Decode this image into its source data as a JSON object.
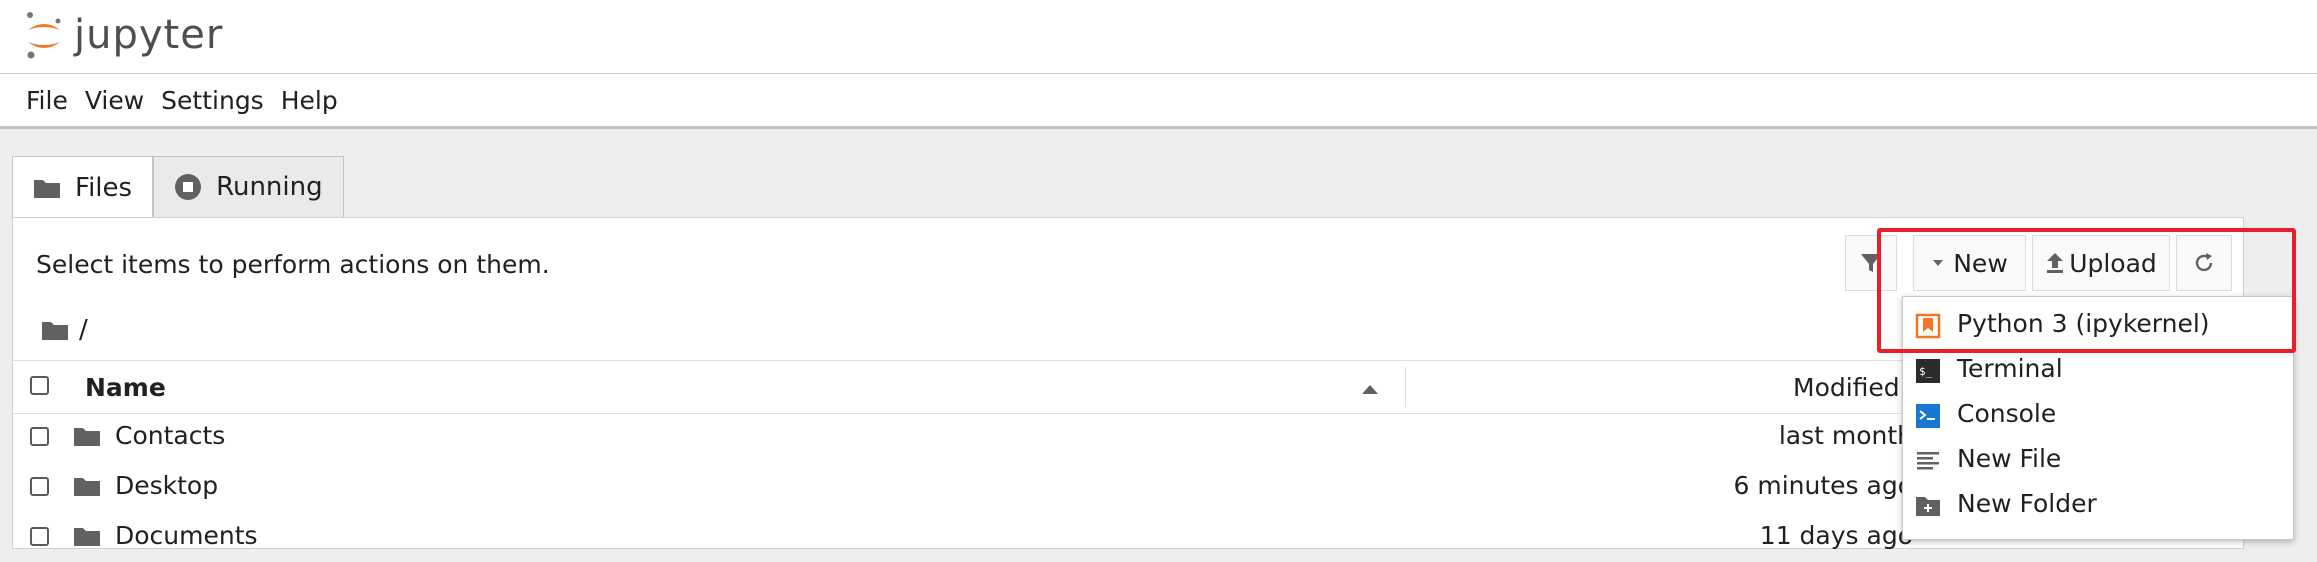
{
  "app": {
    "logo_text": "jupyter"
  },
  "menu": [
    "File",
    "View",
    "Settings",
    "Help"
  ],
  "tabs": [
    {
      "label": "Files",
      "icon": "folder-icon",
      "active": true
    },
    {
      "label": "Running",
      "icon": "stop-circle-icon",
      "active": false
    }
  ],
  "panel": {
    "hint": "Select items to perform actions on them.",
    "breadcrumb": "/",
    "toolbar": {
      "filter_icon": "filter-icon",
      "new_label": "New",
      "upload_label": "Upload",
      "refresh_icon": "refresh-icon"
    },
    "columns": {
      "name": "Name",
      "modified": "Modified"
    },
    "rows": [
      {
        "name": "Contacts",
        "modified": "last month"
      },
      {
        "name": "Desktop",
        "modified": "6 minutes ago"
      },
      {
        "name": "Documents",
        "modified": "11 days ago"
      }
    ]
  },
  "new_menu": [
    {
      "label": "Python 3 (ipykernel)",
      "icon": "python-notebook-icon"
    },
    {
      "label": "Terminal",
      "icon": "terminal-icon"
    },
    {
      "label": "Console",
      "icon": "console-icon"
    },
    {
      "label": "New File",
      "icon": "text-file-icon"
    },
    {
      "label": "New Folder",
      "icon": "new-folder-icon"
    }
  ],
  "colors": {
    "accent_orange": "#f37626",
    "console_blue": "#1976d2",
    "highlight_red": "#e8202a"
  }
}
